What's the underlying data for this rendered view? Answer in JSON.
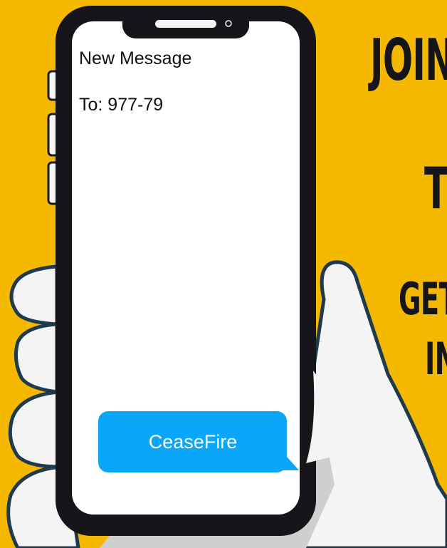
{
  "background_color": "#f5b800",
  "phone": {
    "header": "New Message",
    "recipient": "To: 977-79",
    "message": "CeaseFire",
    "bubble_color": "#0ba6f7"
  },
  "side_text": {
    "line1": "JOIN",
    "line2": "T",
    "line3": "GET",
    "line4": "IN"
  },
  "icons": [
    "phone-speaker-icon",
    "phone-camera-icon"
  ]
}
